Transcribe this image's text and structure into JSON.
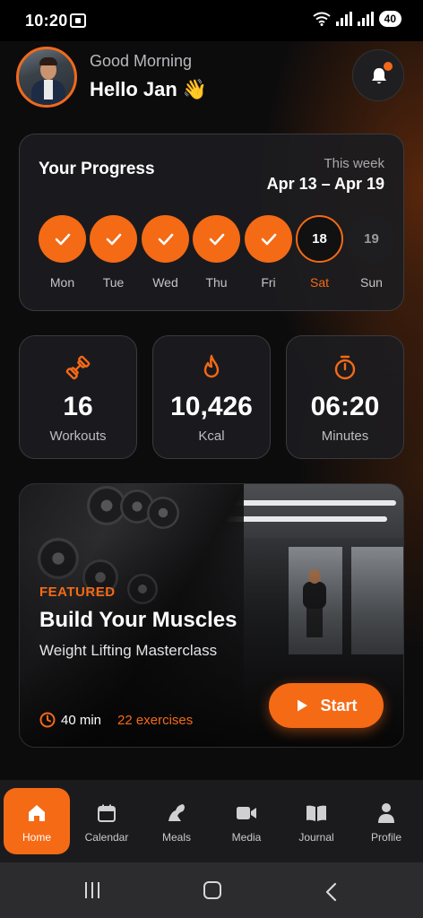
{
  "status_bar": {
    "time": "10:20",
    "battery": "40"
  },
  "header": {
    "greeting": "Good Morning",
    "name": "Hello Jan 👋",
    "notification_icon": "bell-icon",
    "accent": "#f56a15"
  },
  "progress": {
    "title": "Your Progress",
    "period_label": "This week",
    "range": "Apr 13 – Apr 19",
    "days": [
      {
        "label": "Mon",
        "value": "",
        "state": "done"
      },
      {
        "label": "Tue",
        "value": "",
        "state": "done"
      },
      {
        "label": "Wed",
        "value": "",
        "state": "done"
      },
      {
        "label": "Thu",
        "value": "",
        "state": "done"
      },
      {
        "label": "Fri",
        "value": "",
        "state": "done"
      },
      {
        "label": "Sat",
        "value": "18",
        "state": "today"
      },
      {
        "label": "Sun",
        "value": "19",
        "state": "future"
      }
    ]
  },
  "stats": [
    {
      "value": "16",
      "label": "Workouts",
      "icon": "dumbbell-icon"
    },
    {
      "value": "10,426",
      "label": "Kcal",
      "icon": "flame-icon"
    },
    {
      "value": "06:20",
      "label": "Minutes",
      "icon": "stopwatch-icon"
    }
  ],
  "featured": {
    "tag": "FEATURED",
    "title": "Build Your Muscles",
    "subtitle": "Weight Lifting Masterclass",
    "duration": "40 min",
    "exercises": "22 exercises",
    "button": "Start"
  },
  "nav": [
    {
      "label": "Home",
      "icon": "home-icon",
      "active": true
    },
    {
      "label": "Calendar",
      "icon": "calendar-icon",
      "active": false
    },
    {
      "label": "Meals",
      "icon": "meals-icon",
      "active": false
    },
    {
      "label": "Media",
      "icon": "video-icon",
      "active": false
    },
    {
      "label": "Journal",
      "icon": "book-icon",
      "active": false
    },
    {
      "label": "Profile",
      "icon": "person-icon",
      "active": false
    }
  ]
}
